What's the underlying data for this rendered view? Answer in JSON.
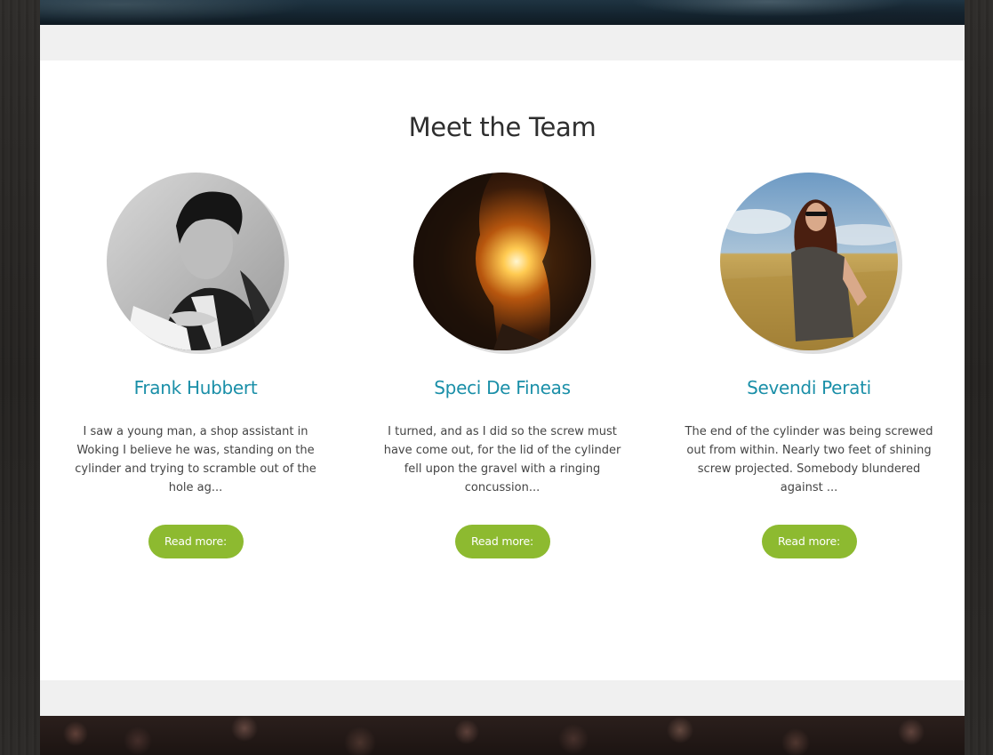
{
  "section": {
    "title": "Meet the Team"
  },
  "members": [
    {
      "name": "Frank Hubbert",
      "bio": "I saw a young man, a shop assistant in Woking I believe he was, standing on the cylinder and trying to scramble out of the hole ag...",
      "button_label": "Read more:",
      "photo_icon": "person-portrait-bw"
    },
    {
      "name": "Speci De Fineas",
      "bio": "I turned, and as I did so the screw must have come out, for the lid of the cylinder fell upon the gravel with a ringing concussion...",
      "button_label": "Read more:",
      "photo_icon": "sunset-silhouette"
    },
    {
      "name": "Sevendi Perati",
      "bio": "The end of the cylinder was being screwed out from within. Nearly two feet of shining screw projected. Somebody blundered against ...",
      "button_label": "Read more:",
      "photo_icon": "woman-in-field"
    }
  ],
  "colors": {
    "accent_name": "#1a8fa8",
    "button_bg": "#8dba30",
    "section_bg": "#ffffff",
    "spacer_bg": "#f0f0f0"
  }
}
